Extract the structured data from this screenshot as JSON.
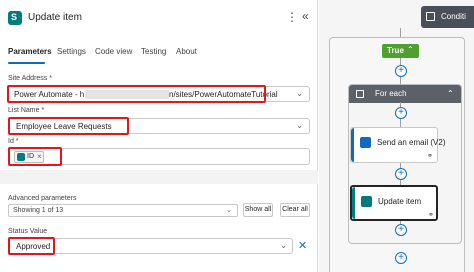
{
  "panel": {
    "title": "Update item",
    "menu_glyph": "⋮",
    "collapse_glyph": "«",
    "tabs": [
      {
        "label": "Parameters",
        "active": true
      },
      {
        "label": "Settings",
        "active": false
      },
      {
        "label": "Code view",
        "active": false
      },
      {
        "label": "Testing",
        "active": false
      },
      {
        "label": "About",
        "active": false
      }
    ]
  },
  "fields": {
    "site_address": {
      "label": "Site Address *",
      "value_prefix": "Power Automate - h",
      "value_suffix": "n/sites/PowerAutomateTutorial"
    },
    "list_name": {
      "label": "List Name *",
      "value": "Employee Leave Requests"
    },
    "id": {
      "label": "Id *",
      "token": "ID",
      "token_remove": "×"
    },
    "advanced": {
      "label": "Advanced parameters",
      "value": "Showing 1 of 13",
      "show_all": "Show all",
      "clear_all": "Clear all"
    },
    "status_value": {
      "label": "Status Value",
      "value": "Approved",
      "clear_glyph": "✕"
    }
  },
  "canvas": {
    "condition_label": "Conditi",
    "true_label": "True",
    "foreach_label": "For each",
    "actions": [
      {
        "label": "Send an email (V2)",
        "icon": "outlook-icon"
      },
      {
        "label": "Update item",
        "icon": "sharepoint-icon"
      }
    ],
    "plus_glyph": "+"
  },
  "colors": {
    "highlight": "#e4161b",
    "accent": "#0f6cbd",
    "true_green": "#4ea12f",
    "sharepoint": "#037c7e",
    "outlook": "#0f6cbd"
  }
}
